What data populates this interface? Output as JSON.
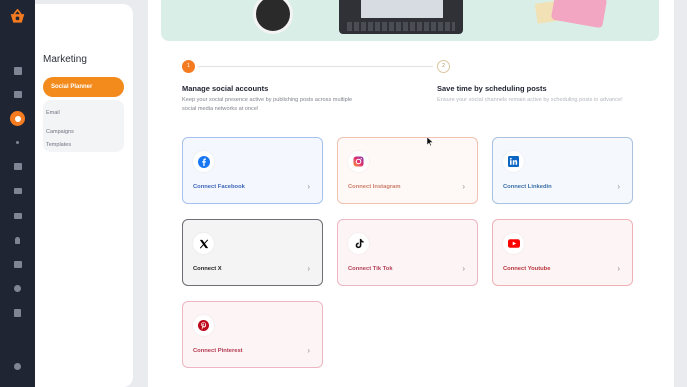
{
  "rail": {
    "icons": [
      "logo-basket-icon",
      "dashboard-icon",
      "calendar-icon",
      "marketing-icon",
      "dot-icon",
      "gallery-icon",
      "monitor-icon",
      "folder-icon",
      "pin-icon",
      "list-icon",
      "dollar-icon",
      "document-icon",
      "settings-icon"
    ],
    "active": "marketing-icon",
    "accent": "#f47b20"
  },
  "subnav": {
    "title": "Marketing",
    "active_item": "Social Planner",
    "items": [
      "Email",
      "Campaigns",
      "Templates"
    ]
  },
  "steps": [
    {
      "number": "1",
      "title": "Manage social accounts",
      "description": "Keep your social presence active by publishing posts across multiple social media networks at once!"
    },
    {
      "number": "2",
      "title": "Save time by scheduling posts",
      "description": "Ensure your social channels remain active by scheduling posts in advance!"
    }
  ],
  "cards": {
    "facebook": {
      "label": "Connect Facebook",
      "icon": "facebook-icon",
      "color": "#1877f2"
    },
    "instagram": {
      "label": "Connect Instagram",
      "icon": "instagram-icon",
      "color": "#e1306c"
    },
    "linkedin": {
      "label": "Connect Linkedin",
      "icon": "linkedin-icon",
      "color": "#0a66c2"
    },
    "x": {
      "label": "Connect X",
      "icon": "x-icon",
      "color": "#000000"
    },
    "tiktok": {
      "label": "Connect Tik Tok",
      "icon": "tiktok-icon",
      "color": "#000000"
    },
    "youtube": {
      "label": "Connect Youtube",
      "icon": "youtube-icon",
      "color": "#ff0000"
    },
    "pinterest": {
      "label": "Connect Pinterest",
      "icon": "pinterest-icon",
      "color": "#bd081c"
    }
  },
  "chevron": "›"
}
